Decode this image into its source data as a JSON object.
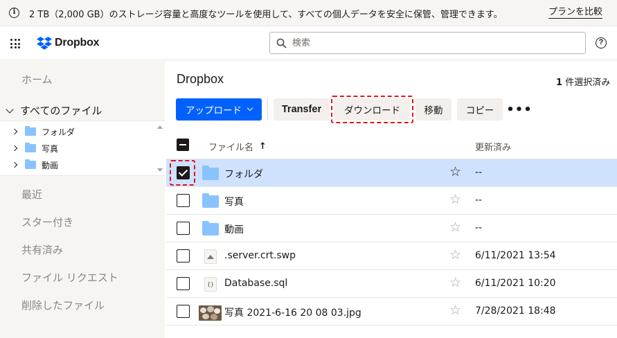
{
  "banner": {
    "message": "2 TB（2,000 GB）のストレージ容量と高度なツールを使用して、すべての個人データを安全に保管、管理できます。",
    "link": "プランを比較"
  },
  "header": {
    "logo_text": "Dropbox",
    "search_placeholder": "検索",
    "brand_color": "#0061fe"
  },
  "sidebar": {
    "home": "ホーム",
    "all_files": "すべてのファイル",
    "tree": [
      {
        "label": "フォルダ"
      },
      {
        "label": "写真"
      },
      {
        "label": "動画"
      }
    ],
    "links": [
      "最近",
      "スター付き",
      "共有済み",
      "ファイル リクエスト",
      "削除したファイル"
    ]
  },
  "main": {
    "title": "Dropbox",
    "selection_count": "1",
    "selection_suffix": "件選択済み",
    "toolbar": {
      "upload": "アップロード",
      "transfer": "Transfer",
      "download": "ダウンロード",
      "move": "移動",
      "copy": "コピー",
      "more": "•••"
    },
    "table": {
      "col_name": "ファイル名",
      "col_modified": "更新済み",
      "rows": [
        {
          "name": "フォルダ",
          "modified": "--",
          "type": "folder",
          "selected": true,
          "starred": true
        },
        {
          "name": "写真",
          "modified": "--",
          "type": "folder",
          "selected": false,
          "starred": false
        },
        {
          "name": "動画",
          "modified": "--",
          "type": "folder",
          "selected": false,
          "starred": false
        },
        {
          "name": ".server.crt.swp",
          "modified": "6/11/2021 13:54",
          "type": "file",
          "selected": false,
          "starred": false
        },
        {
          "name": "Database.sql",
          "modified": "6/11/2021 10:20",
          "type": "code-file",
          "icon_text": "{}",
          "selected": false,
          "starred": false
        },
        {
          "name": "写真 2021-6-16 20 08 03.jpg",
          "modified": "7/28/2021 18:48",
          "type": "image",
          "selected": false,
          "starred": false
        }
      ]
    }
  },
  "annotation_color": "#e8101a"
}
